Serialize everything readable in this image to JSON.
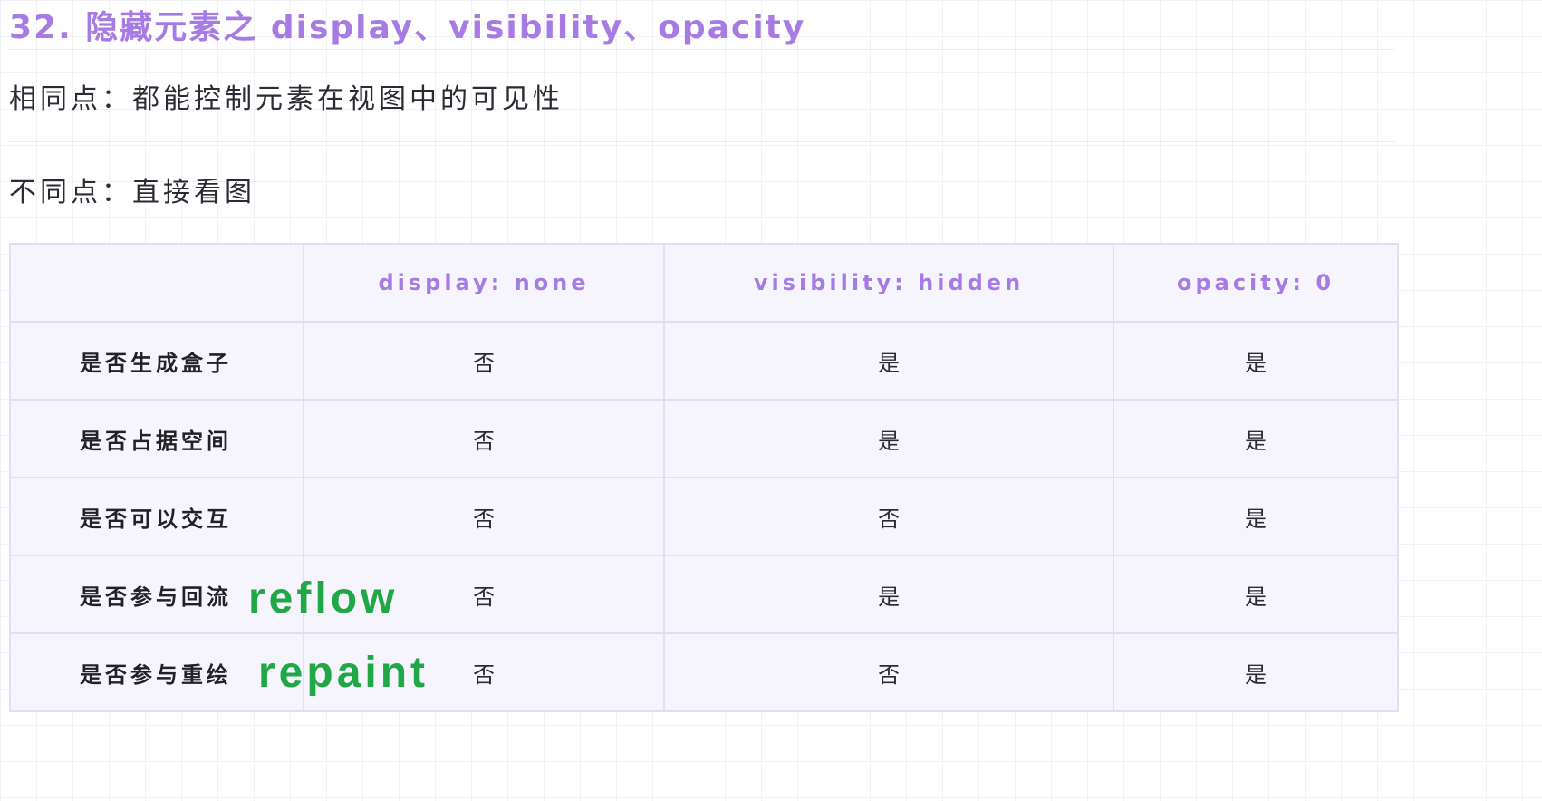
{
  "heading": "32. 隐藏元素之 display、visibility、opacity",
  "paragraphs": {
    "same": "相同点：都能控制元素在视图中的可见性",
    "diff": "不同点：直接看图"
  },
  "table": {
    "headers": [
      "",
      "display: none",
      "visibility: hidden",
      "opacity: 0"
    ],
    "rows": [
      {
        "label": "是否生成盒子",
        "cells": [
          "否",
          "是",
          "是"
        ]
      },
      {
        "label": "是否占据空间",
        "cells": [
          "否",
          "是",
          "是"
        ]
      },
      {
        "label": "是否可以交互",
        "cells": [
          "否",
          "否",
          "是"
        ]
      },
      {
        "label": "是否参与回流",
        "cells": [
          "否",
          "是",
          "是"
        ],
        "annotation": "reflow"
      },
      {
        "label": "是否参与重绘",
        "cells": [
          "否",
          "否",
          "是"
        ],
        "annotation": "repaint"
      }
    ]
  },
  "colors": {
    "heading": "#a77be4",
    "table_bg": "#f6f4fd",
    "table_border": "#e3dcf5",
    "annotation": "#21a846"
  }
}
